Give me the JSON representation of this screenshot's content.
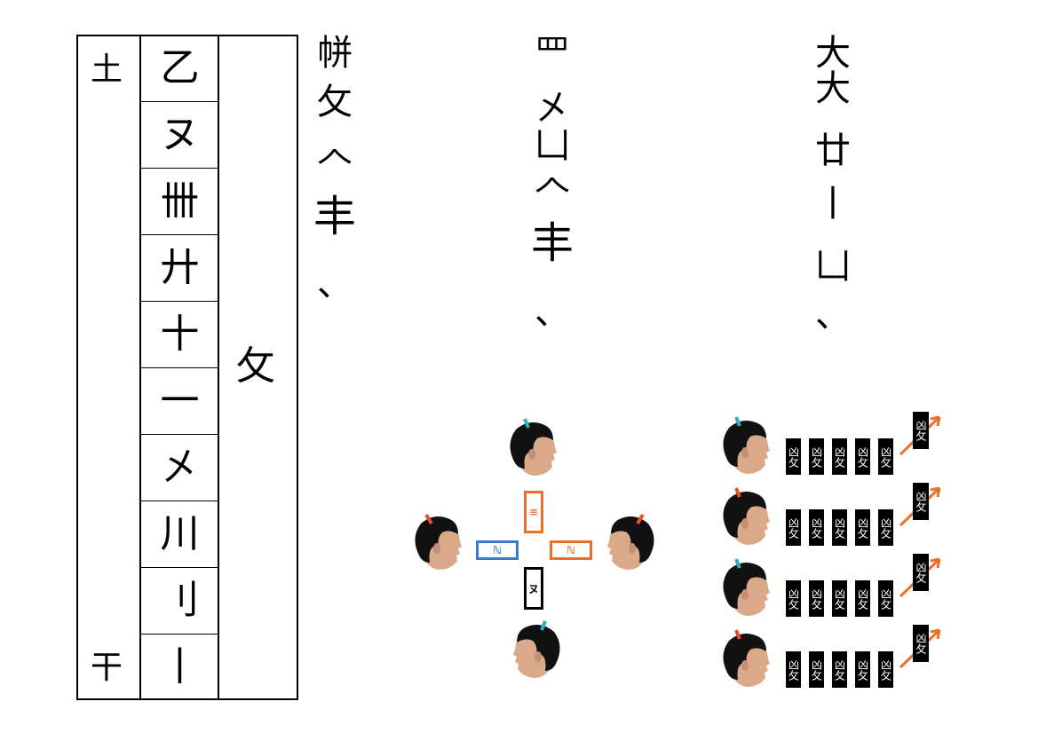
{
  "table": {
    "top_left": "土",
    "bottom_left": "干",
    "right_big": "攵",
    "cells": [
      "乙",
      "ヌ",
      "卌",
      "廾",
      "十",
      "一",
      "㐅",
      "川",
      "刂",
      "丨"
    ]
  },
  "columns": [
    {
      "chars": [
        "帡",
        "攵",
        "𠆢",
        "丰",
        "、"
      ]
    },
    {
      "chars": [
        "罒",
        "㐅",
        "凵",
        "𠆢",
        "丰",
        "、"
      ]
    },
    {
      "chars": [
        "大",
        "大",
        "廿",
        "丨",
        "凵",
        "、"
      ]
    }
  ],
  "cross": {
    "top_tag": "≡",
    "left_tag": "ℕ",
    "right_tag": "ℕ",
    "bottom_tag": "ヌ",
    "colors": {
      "orange": "#e8702a",
      "blue": "#3a7cc5",
      "black": "#000000",
      "skin": "#d9a98a",
      "hair": "#111111",
      "tie_teal": "#2bb3c0",
      "tie_red": "#e8502a"
    }
  },
  "rows": {
    "tile_text": "凶攵",
    "end_tile_text": "凶攵"
  }
}
